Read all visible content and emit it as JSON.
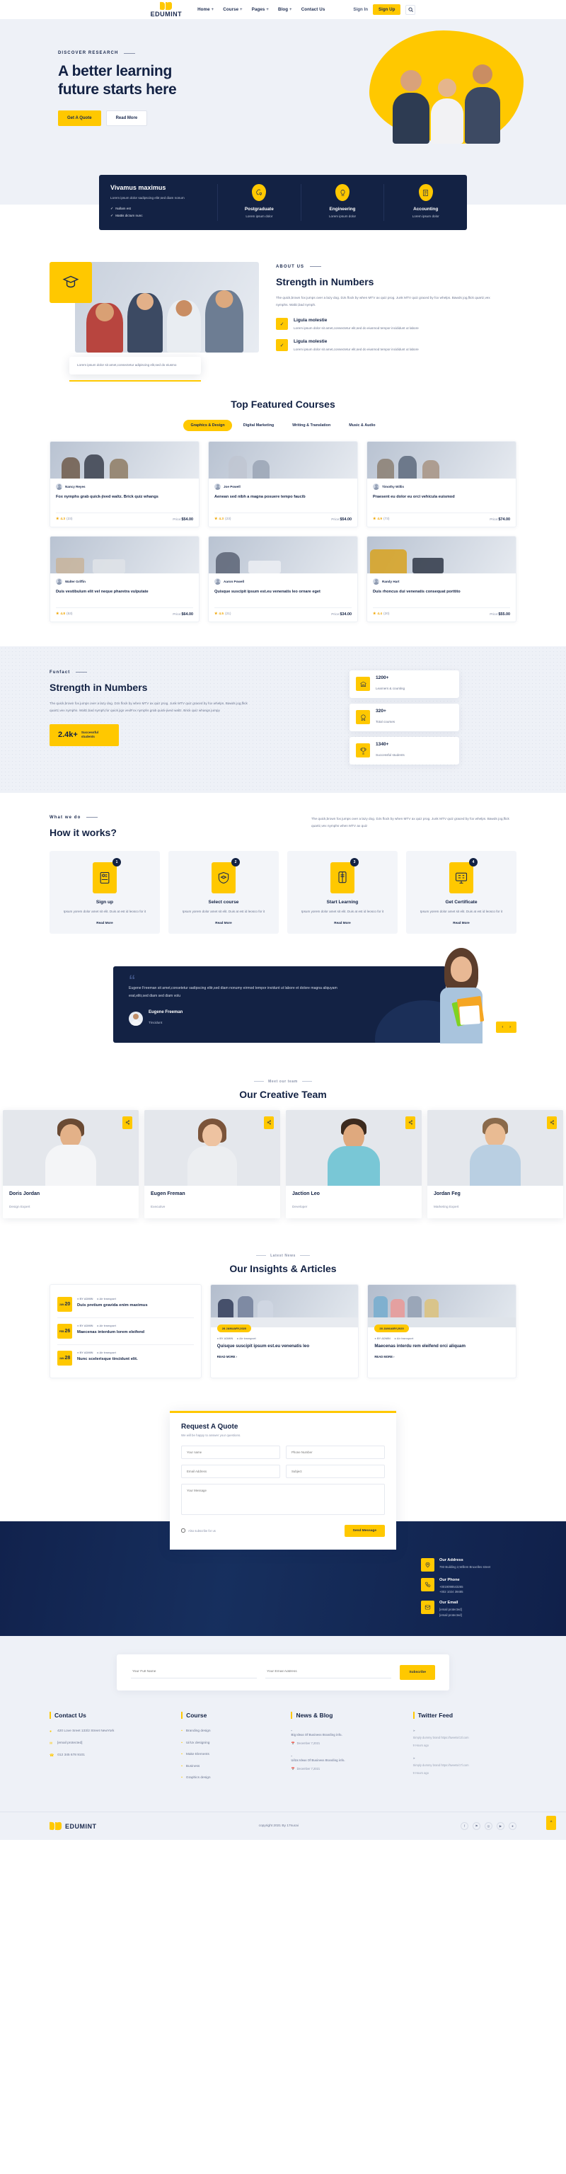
{
  "brand": {
    "name": "EDUMINT",
    "accent": "#FFC800",
    "dark": "#132244"
  },
  "header": {
    "nav": [
      {
        "label": "Home",
        "caret": "+"
      },
      {
        "label": "Course",
        "caret": "+"
      },
      {
        "label": "Pages",
        "caret": "+"
      },
      {
        "label": "Blog",
        "caret": "+"
      },
      {
        "label": "Contact Us",
        "caret": ""
      }
    ],
    "sign_in": "Sign In",
    "sign_up": "Sign Up"
  },
  "hero": {
    "eyebrow": "DISCOVER RESEARCH",
    "title_line1": "A better learning",
    "title_line2": "future starts here",
    "btn_primary": "Get A Quote",
    "btn_secondary": "Read More"
  },
  "feature_bar": {
    "title": "Vivamus maximus",
    "desc": "Lorem ipsum dolor sadipscing elitr,sed diam nonum",
    "checks": [
      "Nullam est",
      "Mattis dictum nunc"
    ],
    "items": [
      {
        "title": "Postgraduate",
        "sub": "Lorem ipsum dolor",
        "icon": "brain-idea-icon"
      },
      {
        "title": "Engineering",
        "sub": "Lorem ipsum dolor",
        "icon": "lightbulb-icon"
      },
      {
        "title": "Accounting",
        "sub": "Lorem ipsum dolor",
        "icon": "document-icon"
      }
    ]
  },
  "about": {
    "eyebrow": "ABOUT US",
    "title": "Strength in Numbers",
    "lead": "The quick,brown fox jumps over a lazy dog. DJs flock by when MTV ax quiz prog. Junk MTV quiz graced by fox whelps. Bawds jog,flick quartz,vex nymphs. Waltz,bad nymph.",
    "caption": "Lorem ipsum dolor sit amet,consectetur adipiscing elit,sed do eiusmo",
    "items": [
      {
        "title": "Ligula molestie",
        "desc": "Lorem ipsum dolor sit amet,consectetur elit,sed do eiusmod tempor incididunt ut labore"
      },
      {
        "title": "Ligula molestie",
        "desc": "Lorem ipsum dolor sit amet,consectetur elit,sed do eiusmod tempor incididunt ut labore"
      }
    ]
  },
  "courses": {
    "title": "Top Featured Courses",
    "tabs": [
      "Graphics & Design",
      "Digital Marketing",
      "Writing & Translation",
      "Music & Audio"
    ],
    "active_tab": "Graphics & Design",
    "price_label": "Price:",
    "cards": [
      {
        "author": "Nancy Reyes",
        "title": "Fox nymphs grab quick-jived waltz. Brick quiz whangs",
        "rating": "4.3",
        "count": "(23)",
        "price": "$54.00"
      },
      {
        "author": "Joe Powell",
        "title": "Aenean sed nibh a magna posuere tempo faucib",
        "rating": "4.3",
        "count": "(23)",
        "price": "$54.00"
      },
      {
        "author": "Timothy Willis",
        "title": "Praesent eu dolor eu orci vehicula euismod",
        "rating": "4.9",
        "count": "(73)",
        "price": "$74.00"
      },
      {
        "author": "Walter Griffin",
        "title": "Duis vestibulum elit vel neque pharetra vulputate",
        "rating": "4.8",
        "count": "(53)",
        "price": "$64.00"
      },
      {
        "author": "Aaron Powell",
        "title": "Quisque suscipit ipsum est.eu venenatis leo ornare eget",
        "rating": "4.5",
        "count": "(21)",
        "price": "$34.00"
      },
      {
        "author": "Randy Hart",
        "title": "Duis rhoncus dui venenatis consequat porttito",
        "rating": "4.4",
        "count": "(20)",
        "price": "$55.00"
      }
    ]
  },
  "funfact": {
    "eyebrow": "Funfact",
    "title": "Strength in Numbers",
    "desc": "The quick,brown fox jumps over a lazy dog. DJs flock by when MTV ax quiz prog. Junk MTV quiz graced by fox whelps. Bawds jog,flick quartz,vex nymphs. Waltz,bad nymph,for quick jigs vexlFox nymphs grab quick-jived waltz. Brick quiz whangs jumpy",
    "badge_number": "2.4k+",
    "badge_label": "Successful students",
    "stats": [
      {
        "number": "1200+",
        "label": "Learners & counting",
        "icon": "institute-icon"
      },
      {
        "number": "320+",
        "label": "Total courses",
        "icon": "badge-icon"
      },
      {
        "number": "1340+",
        "label": "Successful students",
        "icon": "trophy-icon"
      }
    ]
  },
  "how": {
    "eyebrow": "What we do",
    "title": "How it works?",
    "desc": "The quick,brown fox jumps over a lazy dog. DJs flock by when MTV ax quiz prog. Junk MTV quiz graced by fox whelps. Bawds jog,flick quartz,vex nymphs when MTV ax quiz",
    "read_more": "Read More",
    "steps": [
      {
        "num": "1",
        "title": "Sign up",
        "desc": "Ipsum yorem dolor amet sit elit. Duis at est id leosco for it",
        "icon": "signup-form-icon"
      },
      {
        "num": "2",
        "title": "Select course",
        "desc": "Ipsum yorem dolor amet sit elit. Duis at est id leosco for it",
        "icon": "shield-graduate-icon"
      },
      {
        "num": "3",
        "title": "Start Learning",
        "desc": "Ipsum yorem dolor amet sit elit. Duis at est id leosco for it",
        "icon": "mobile-book-icon"
      },
      {
        "num": "4",
        "title": "Get Certificate",
        "desc": "Ipsum yorem dolor amet sit elit. Duis at est id leosco for it",
        "icon": "monitor-class-icon"
      }
    ]
  },
  "testimonial": {
    "quote": "Eugene Freeman sit amet,consetetur sadipscing elitr,sed diam nonumy eirmod tempor invidunt ut labore et dolore magna aliquyam erat,elitr,sed diam sed diam volu",
    "name": "Eugene Freeman",
    "role": "Tincidunt",
    "prev": "‹",
    "next": "›"
  },
  "team": {
    "eyebrow": "Meet our team",
    "title": "Our Creative Team",
    "members": [
      {
        "name": "Doris Jordan",
        "role": "Design Expert"
      },
      {
        "name": "Eugen Freman",
        "role": "Executive"
      },
      {
        "name": "Jaction Leo",
        "role": "Developer"
      },
      {
        "name": "Jordan Feg",
        "role": "Marketing Expert"
      }
    ]
  },
  "blog": {
    "eyebrow": "Latest News",
    "title": "Our Insights & Articles",
    "by": "BY ADMIN",
    "cat": "Air transport",
    "read_more": "READ MORE",
    "list": [
      {
        "mon": "JAN",
        "day": "20",
        "title": "Duis pretium gravida enim maximus"
      },
      {
        "mon": "FEB",
        "day": "26",
        "title": "Maecenas interdum lorem eleifend"
      },
      {
        "mon": "JAN",
        "day": "28",
        "title": "Nunc scelerisque tincidunt elit."
      }
    ],
    "cards": [
      {
        "tag": "28 JANUARY,2020",
        "title": "Quisque suscipit ipsum est.eu venenatis leo"
      },
      {
        "tag": "28 JANUARY,2020",
        "title": "Maecenas interdu rem eleifend orci aliquam"
      }
    ]
  },
  "quote_form": {
    "title": "Request A Quote",
    "sub": "We will be happy to answer your questions.",
    "ph_name": "Your name",
    "ph_phone": "Phone Number",
    "ph_email": "Email Address",
    "ph_subject": "Subject",
    "ph_message": "Your Message",
    "checkbox": "Also subscribe for us",
    "submit": "Send Message"
  },
  "contact_band": {
    "items": [
      {
        "title": "Our Address",
        "lines": "793 Building 2,Willem Bruxelles street",
        "icon": "location-pin-icon"
      },
      {
        "title": "Our Phone",
        "lines": "+0019098543265\n+002 1024 39485",
        "icon": "phone-icon"
      },
      {
        "title": "Our Email",
        "lines": "[email protected]\n[email protected]",
        "icon": "envelope-icon"
      }
    ]
  },
  "newsletter": {
    "ph_name": "Your Full Name",
    "ph_email": "Your Email Address",
    "button": "Subscribe"
  },
  "footer": {
    "contact": {
      "title": "Contact Us",
      "address": "420 Love Sreet 133/2 Street NewYork",
      "email": "[email protected]",
      "phone": "012 345 678 9101"
    },
    "course": {
      "title": "Course",
      "items": [
        "Branding design",
        "Ui/Ux designing",
        "Make Elements",
        "Business",
        "Graphics design"
      ]
    },
    "news": {
      "title": "News & Blog",
      "items": [
        {
          "title": "Big Ideas Of Business Branding info.",
          "date": "December 7,2021"
        },
        {
          "title": "Ui/Ux Ideas Of Business Branding info.",
          "date": "December 7,2021"
        }
      ]
    },
    "twitter": {
      "title": "Twitter Feed",
      "items": [
        {
          "text": "Simply dummy brand https://tweets/c3l.com",
          "time": "9 Hours ago"
        },
        {
          "text": "Simply dummy brand https://tweets/c7l.com",
          "time": "9 Hours ago"
        }
      ]
    },
    "copyright": "copyright 2021 By 17sucai",
    "socials": [
      "f",
      "⚑",
      "◎",
      "▶",
      "●"
    ],
    "to_top": "^"
  }
}
